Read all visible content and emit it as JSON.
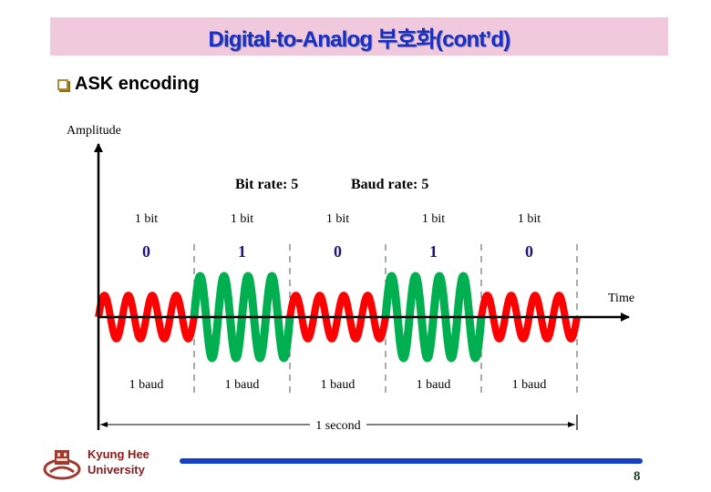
{
  "slide": {
    "title": "Digital-to-Analog 부호화(cont’d)",
    "bullet": "ASK encoding",
    "page_number": "8"
  },
  "footer": {
    "university_line1": "Kyung Hee",
    "university_line2": "University"
  },
  "diagram": {
    "y_axis_label": "Amplitude",
    "x_axis_label": "Time",
    "bit_rate_label": "Bit rate: 5",
    "baud_rate_label": "Baud rate: 5",
    "duration_label": "1 second",
    "segments": [
      {
        "bit_label": "1 bit",
        "bit": "0",
        "baud_label": "1 baud"
      },
      {
        "bit_label": "1 bit",
        "bit": "1",
        "baud_label": "1 baud"
      },
      {
        "bit_label": "1 bit",
        "bit": "0",
        "baud_label": "1 baud"
      },
      {
        "bit_label": "1 bit",
        "bit": "1",
        "baud_label": "1 baud"
      },
      {
        "bit_label": "1 bit",
        "bit": "0",
        "baud_label": "1 baud"
      }
    ],
    "cycles_per_segment": 4,
    "amplitude_ratio_low_to_high": 0.53,
    "colors": {
      "bit_0_wave": "#ff0000",
      "bit_1_wave": "#00b050",
      "bit_digit": "#1f1580"
    }
  }
}
